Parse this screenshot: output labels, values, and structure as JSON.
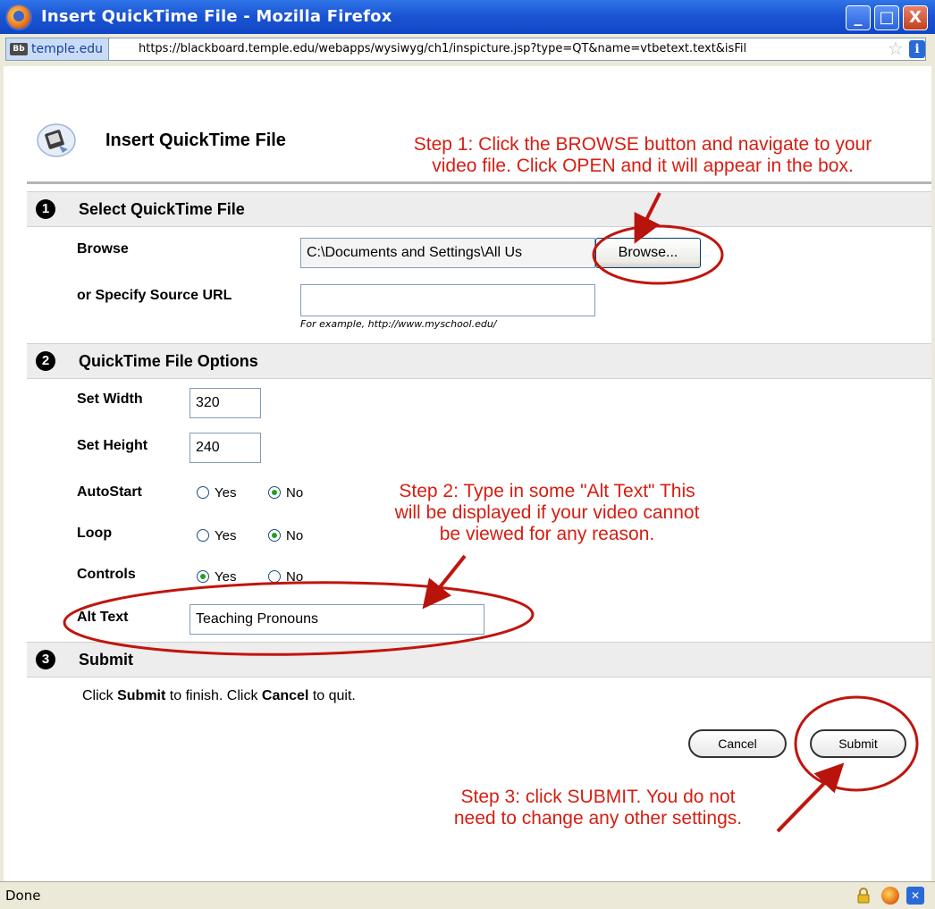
{
  "window": {
    "title": "Insert QuickTime File - Mozilla Firefox",
    "minimize_glyph": "_",
    "maximize_glyph": "□",
    "close_glyph": "X"
  },
  "addressbar": {
    "site_badge": "Bb",
    "site": "temple.edu",
    "url": "https://blackboard.temple.edu/webapps/wysiwyg/ch1/inspicture.jsp?type=QT&name=vtbetext.text&isFil"
  },
  "page": {
    "title": "Insert QuickTime File"
  },
  "sections": {
    "s1": {
      "number": "1",
      "title": "Select QuickTime File"
    },
    "s2": {
      "number": "2",
      "title": "QuickTime File Options"
    },
    "s3": {
      "number": "3",
      "title": "Submit"
    }
  },
  "select_file": {
    "browse_label": "Browse",
    "browse_value": "C:\\Documents and Settings\\All Us",
    "browse_button": "Browse...",
    "url_label": "or Specify Source URL",
    "url_value": "",
    "url_hint": "For example, http://www.myschool.edu/"
  },
  "options": {
    "width_label": "Set Width",
    "width_value": "320",
    "height_label": "Set Height",
    "height_value": "240",
    "autostart_label": "AutoStart",
    "autostart_selected": "No",
    "loop_label": "Loop",
    "loop_selected": "No",
    "controls_label": "Controls",
    "controls_selected": "Yes",
    "yes_label": "Yes",
    "no_label": "No",
    "alt_label": "Alt Text",
    "alt_value": "Teaching Pronouns"
  },
  "submit": {
    "instr_pre": "Click ",
    "instr_submit": "Submit",
    "instr_mid": " to finish. Click ",
    "instr_cancel": "Cancel",
    "instr_post": " to quit.",
    "cancel_button": "Cancel",
    "submit_button": "Submit"
  },
  "annotations": {
    "step1_line1": "Step 1: Click the BROWSE button and navigate to your",
    "step1_line2": "video file.  Click OPEN and it will appear in the box.",
    "step2_line1": "Step 2: Type in some \"Alt Text\"  This",
    "step2_line2": "will be displayed if your video cannot",
    "step2_line3": "be viewed for any reason.",
    "step3_line1": "Step 3: click SUBMIT.  You do not",
    "step3_line2": "need to change any other settings.",
    "color": "#d61e12"
  },
  "statusbar": {
    "text": "Done",
    "extension_glyph": "✕"
  }
}
